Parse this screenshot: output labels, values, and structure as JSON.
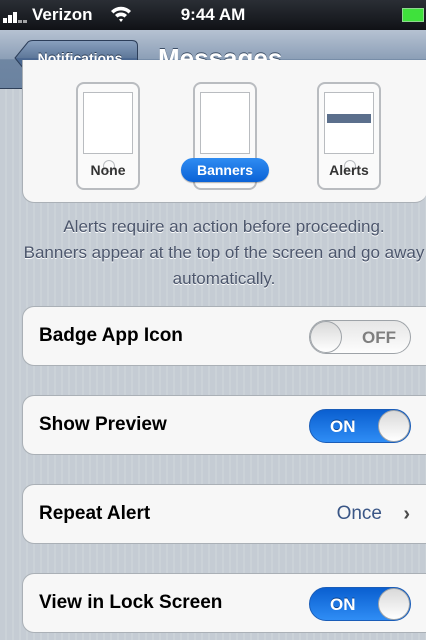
{
  "status_bar": {
    "carrier": "Verizon",
    "time": "9:44 AM",
    "signal_icon": "signal-bars-icon",
    "wifi_icon": "wifi-icon",
    "battery_icon": "battery-icon"
  },
  "nav": {
    "back_label": "Notifications",
    "title": "Messages"
  },
  "alert_style": {
    "options": [
      {
        "label": "None",
        "selected": false
      },
      {
        "label": "Banners",
        "selected": true
      },
      {
        "label": "Alerts",
        "selected": false
      }
    ]
  },
  "explanation": {
    "line1": "Alerts require an action before proceeding.",
    "line2": "Banners appear at the top of the screen and go away automatically."
  },
  "settings": {
    "badge_app_icon": {
      "label": "Badge App Icon",
      "toggle": "OFF"
    },
    "show_preview": {
      "label": "Show Preview",
      "toggle": "ON"
    },
    "repeat_alert": {
      "label": "Repeat Alert",
      "value": "Once",
      "chevron": "›"
    },
    "view_in_lock_screen": {
      "label": "View in Lock Screen",
      "toggle": "ON"
    }
  },
  "colors": {
    "accent_blue": "#1a73e8",
    "background_stripes": "#c5ccd4",
    "value_blue": "#3a5686"
  }
}
